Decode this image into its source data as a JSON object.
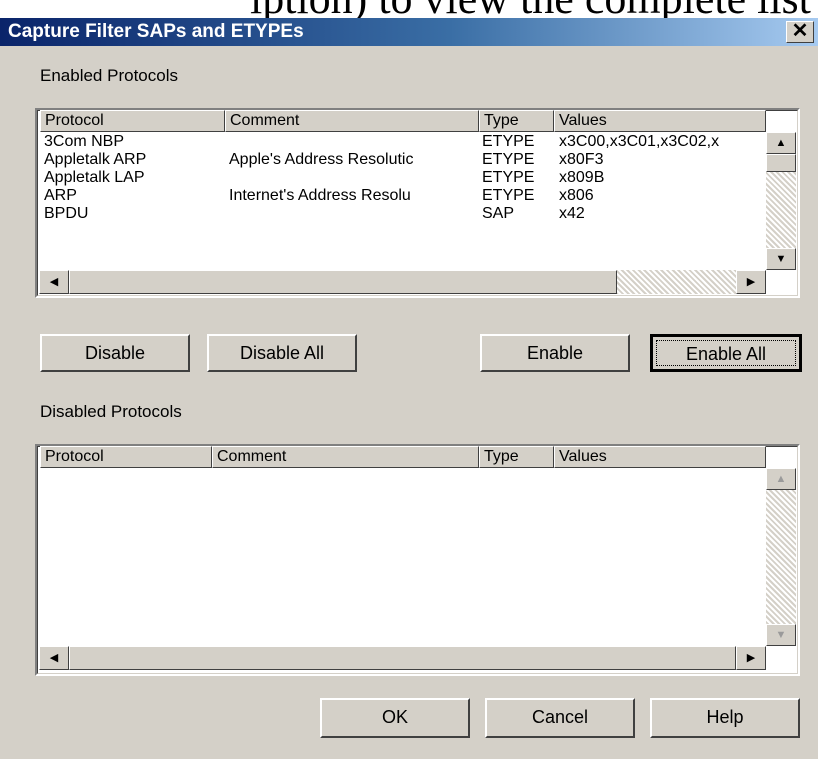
{
  "caption_text": "iption) to view the complete list of",
  "window": {
    "title": "Capture Filter SAPs and ETYPEs",
    "close_glyph": "✕"
  },
  "enabled_section": {
    "label": "Enabled Protocols",
    "columns": [
      "Protocol",
      "Comment",
      "Type",
      "Values"
    ],
    "rows": [
      {
        "protocol": "3Com NBP",
        "comment": "",
        "type": "ETYPE",
        "values": "x3C00,x3C01,x3C02,x"
      },
      {
        "protocol": "Appletalk ARP",
        "comment": "Apple's Address Resolutic",
        "type": "ETYPE",
        "values": "x80F3"
      },
      {
        "protocol": "Appletalk LAP",
        "comment": "",
        "type": "ETYPE",
        "values": "x809B"
      },
      {
        "protocol": "ARP",
        "comment": "Internet's Address Resolu",
        "type": "ETYPE",
        "values": "x806"
      },
      {
        "protocol": "BPDU",
        "comment": "",
        "type": "SAP",
        "values": "x42"
      }
    ]
  },
  "buttons_mid": {
    "disable": "Disable",
    "disable_all": "Disable All",
    "enable": "Enable",
    "enable_all": "Enable All"
  },
  "disabled_section": {
    "label": "Disabled Protocols",
    "columns": [
      "Protocol",
      "Comment",
      "Type",
      "Values"
    ],
    "rows": []
  },
  "buttons_bottom": {
    "ok": "OK",
    "cancel": "Cancel",
    "help": "Help"
  },
  "icons": {
    "up": "▲",
    "down": "▼",
    "left": "◀",
    "right": "▶"
  }
}
